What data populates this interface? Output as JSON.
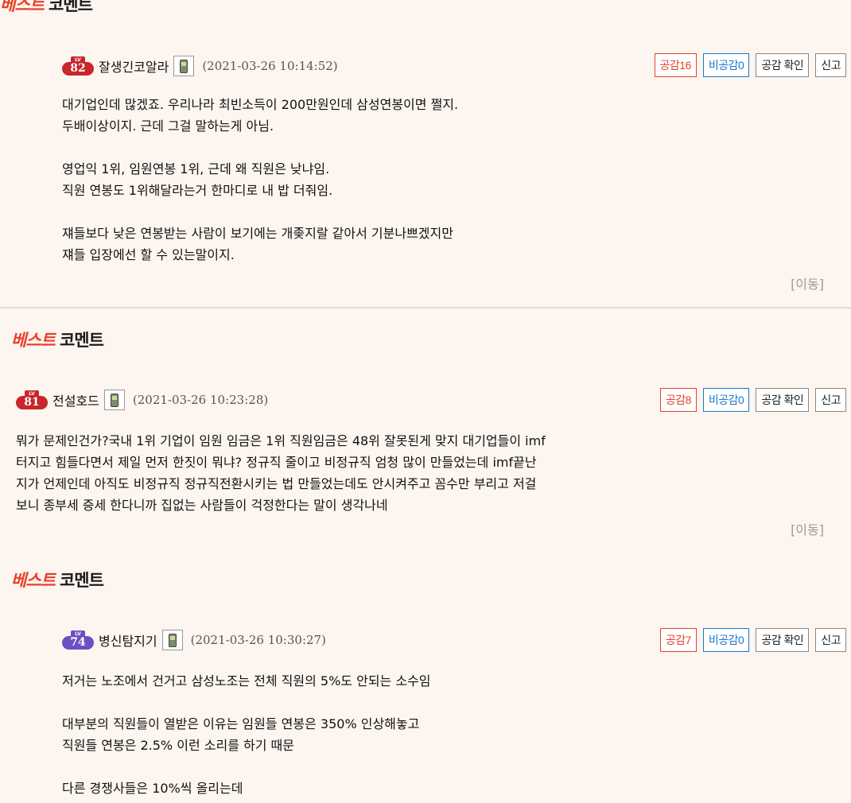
{
  "best_label_part1": "베스트",
  "best_label_part2": "코멘트",
  "comments": [
    {
      "level": "82",
      "lv": "LV",
      "nickname": "잘생긴코알라",
      "date": "(2021-03-26 10:14:52)",
      "like": "공감16",
      "dislike": "비공감0",
      "check": "공감 확인",
      "report": "신고",
      "lines": [
        "대기업인데 많겠죠. 우리나라 최빈소득이 200만원인데 삼성연봉이면 쩔지.",
        "두배이상이지. 근데 그걸 말하는게 아님.",
        "",
        "영업익 1위, 임원연봉 1위, 근데 왜 직원은 낮냐임.",
        "직원 연봉도 1위해달라는거 한마디로 내 밥 더줘임.",
        "",
        "쟤들보다 낮은 연봉받는 사람이 보기에는 개좆지랄 같아서 기분나쁘겠지만",
        "쟤들 입장에선 할 수 있는말이지."
      ],
      "move": "[이동]"
    },
    {
      "level": "81",
      "lv": "LV",
      "nickname": "전설호드",
      "date": "(2021-03-26 10:23:28)",
      "like": "공감8",
      "dislike": "비공감0",
      "check": "공감 확인",
      "report": "신고",
      "lines": [
        "뭐가 문제인건가?국내 1위 기업이 임원 임금은 1위 직원임금은 48위 잘못된게 맞지 대기업들이 imf",
        "터지고 힘들다면서 제일 먼저 한짓이 뭐냐? 정규직 줄이고 비정규직 엄청 많이 만들었는데 imf끝난",
        "지가 언제인데 아직도 비정규직 정규직전환시키는 법 만들었는데도 안시켜주고 꼼수만 부리고 저걸",
        "보니 종부세 증세 한다니까 집없는 사람들이 걱정한다는 말이 생각나네"
      ],
      "move": "[이동]"
    },
    {
      "level": "74",
      "lv": "LV",
      "nickname": "병신탐지기",
      "date": "(2021-03-26 10:30:27)",
      "like": "공감7",
      "dislike": "비공감0",
      "check": "공감 확인",
      "report": "신고",
      "lines": [
        "저거는 노조에서 건거고 삼성노조는 전체 직원의 5%도 안되는 소수임",
        "",
        "대부분의 직원들이 열받은 이유는 임원들 연봉은 350% 인상해놓고",
        "직원들 연봉은 2.5% 이런 소리를 하기 때문",
        "",
        "다른 경쟁사들은 10%씩 올리는데"
      ]
    }
  ]
}
